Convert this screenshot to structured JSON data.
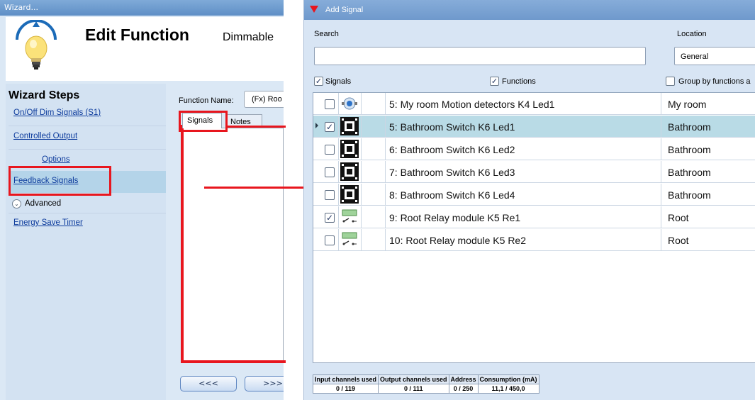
{
  "wizard": {
    "window_title": "Wizard...",
    "title": "Edit Function",
    "subtitle": "Dimmable",
    "steps_title": "Wizard Steps",
    "steps": [
      {
        "label": "On/Off Dim Signals (S1)"
      },
      {
        "label": "Controlled Output"
      },
      {
        "label": "Options"
      },
      {
        "label": "Feedback Signals"
      },
      {
        "label": "Advanced"
      },
      {
        "label": "Energy Save Timer"
      }
    ],
    "function_name_label": "Function Name:",
    "function_name_value": "(Fx) Roo",
    "tabs": [
      {
        "label": "Signals"
      },
      {
        "label": "Notes"
      }
    ],
    "nav": {
      "prev": "<<<",
      "next": ">>>"
    }
  },
  "dialog": {
    "title": "Add Signal",
    "search_label": "Search",
    "search_value": "",
    "location_label": "Location",
    "location_value": "General",
    "filters": [
      {
        "label": "Signals",
        "checked": true
      },
      {
        "label": "Functions",
        "checked": true
      },
      {
        "label": "Group by functions a",
        "checked": false
      }
    ],
    "rows": [
      {
        "checked": false,
        "icon": "motion-sensor-icon",
        "name": "5: My room Motion detectors K4 Led1",
        "location": "My room",
        "selected": false
      },
      {
        "checked": true,
        "icon": "switch-icon",
        "name": "5: Bathroom Switch K6 Led1",
        "location": "Bathroom",
        "selected": true
      },
      {
        "checked": false,
        "icon": "switch-icon",
        "name": "6: Bathroom Switch K6 Led2",
        "location": "Bathroom",
        "selected": false
      },
      {
        "checked": false,
        "icon": "switch-icon",
        "name": "7: Bathroom Switch K6 Led3",
        "location": "Bathroom",
        "selected": false
      },
      {
        "checked": false,
        "icon": "switch-icon",
        "name": "8: Bathroom Switch K6 Led4",
        "location": "Bathroom",
        "selected": false
      },
      {
        "checked": true,
        "icon": "relay-icon",
        "name": "9: Root Relay module K5 Re1",
        "location": "Root",
        "selected": false
      },
      {
        "checked": false,
        "icon": "relay-icon",
        "name": "10: Root Relay module K5 Re2",
        "location": "Root",
        "selected": false
      }
    ],
    "status": {
      "headers": [
        "Input channels used",
        "Output channels used",
        "Address",
        "Consumption (mA)"
      ],
      "values": [
        "0 / 119",
        "0 / 111",
        "0 / 250",
        "11,1 / 450,0"
      ]
    }
  },
  "colors": {
    "highlight_red": "#e8161e",
    "selected_row": "#b9dbe6",
    "link_blue": "#0b3a9c"
  }
}
